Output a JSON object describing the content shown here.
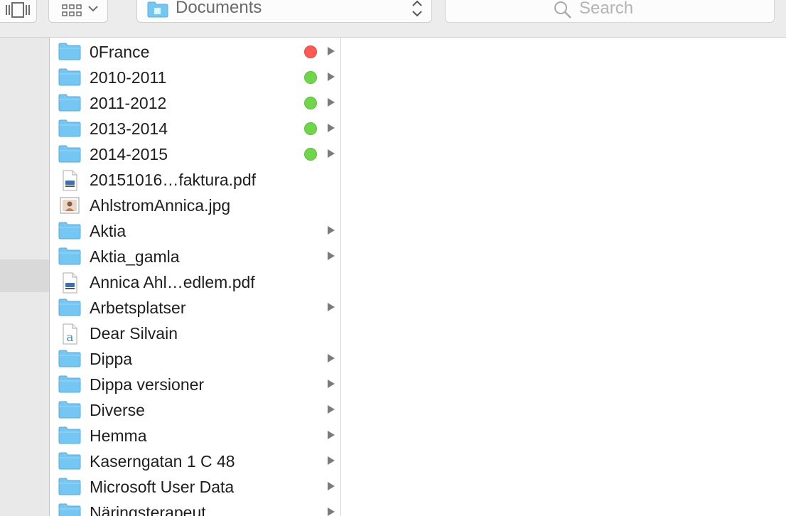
{
  "toolbar": {
    "view_buttons": [
      {
        "name": "cover-flow-icon"
      },
      {
        "name": "arrange-grid-icon"
      }
    ],
    "path": {
      "label": "Documents",
      "icon": "folder-icon"
    },
    "search": {
      "placeholder": "Search",
      "icon": "magnifier-icon"
    }
  },
  "colors": {
    "folder": "#74c6f3",
    "tag_red": "#fd5a53",
    "tag_green": "#6fd64a",
    "disclosure": "#7b7b7b"
  },
  "files": [
    {
      "name": "0France",
      "type": "folder",
      "tag": "red",
      "has_children": true
    },
    {
      "name": "2010-2011",
      "type": "folder",
      "tag": "green",
      "has_children": true
    },
    {
      "name": "2011-2012",
      "type": "folder",
      "tag": "green",
      "has_children": true
    },
    {
      "name": "2013-2014",
      "type": "folder",
      "tag": "green",
      "has_children": true
    },
    {
      "name": "2014-2015",
      "type": "folder",
      "tag": "green",
      "has_children": true
    },
    {
      "name": "20151016…faktura.pdf",
      "type": "pdf",
      "tag": null,
      "has_children": false
    },
    {
      "name": "AhlstromAnnica.jpg",
      "type": "image",
      "tag": null,
      "has_children": false
    },
    {
      "name": "Aktia",
      "type": "folder",
      "tag": null,
      "has_children": true
    },
    {
      "name": "Aktia_gamla",
      "type": "folder",
      "tag": null,
      "has_children": true
    },
    {
      "name": "Annica Ahl…edlem.pdf",
      "type": "pdf",
      "tag": null,
      "has_children": false
    },
    {
      "name": "Arbetsplatser",
      "type": "folder",
      "tag": null,
      "has_children": true
    },
    {
      "name": "Dear Silvain",
      "type": "text",
      "tag": null,
      "has_children": false
    },
    {
      "name": "Dippa",
      "type": "folder",
      "tag": null,
      "has_children": true
    },
    {
      "name": "Dippa versioner",
      "type": "folder",
      "tag": null,
      "has_children": true
    },
    {
      "name": "Diverse",
      "type": "folder",
      "tag": null,
      "has_children": true
    },
    {
      "name": "Hemma",
      "type": "folder",
      "tag": null,
      "has_children": true
    },
    {
      "name": "Kaserngatan 1 C 48",
      "type": "folder",
      "tag": null,
      "has_children": true
    },
    {
      "name": "Microsoft User Data",
      "type": "folder",
      "tag": null,
      "has_children": true
    },
    {
      "name": "Näringsterapeut",
      "type": "folder",
      "tag": null,
      "has_children": true
    }
  ]
}
